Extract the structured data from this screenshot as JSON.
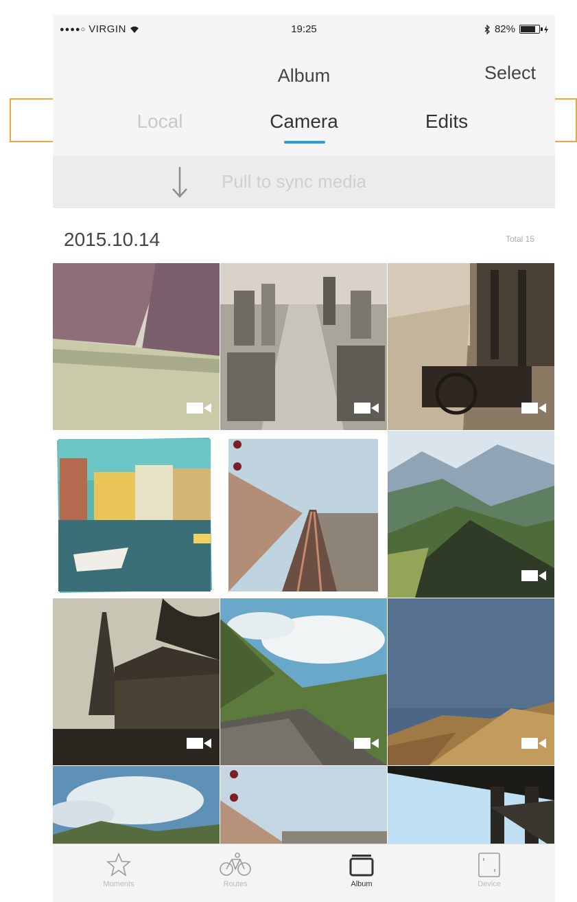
{
  "status_bar": {
    "signal": "●●●●○",
    "carrier": "VIRGIN",
    "time": "19:25",
    "battery_text": "82%",
    "battery_level": 0.82
  },
  "nav": {
    "title": "Album",
    "select_label": "Select"
  },
  "tabs": {
    "local": "Local",
    "camera": "Camera",
    "edits": "Edits",
    "active": "Camera"
  },
  "sync": {
    "label": "Pull to sync media"
  },
  "section": {
    "date": "2015.10.14",
    "total": "Total 15"
  },
  "tabbar": {
    "moments": "Moments",
    "routes": "Routes",
    "album": "Album",
    "device": "Device",
    "active": "Album"
  },
  "colors": {
    "accent": "#2e9bdc",
    "highlight": "#f2a53a"
  }
}
